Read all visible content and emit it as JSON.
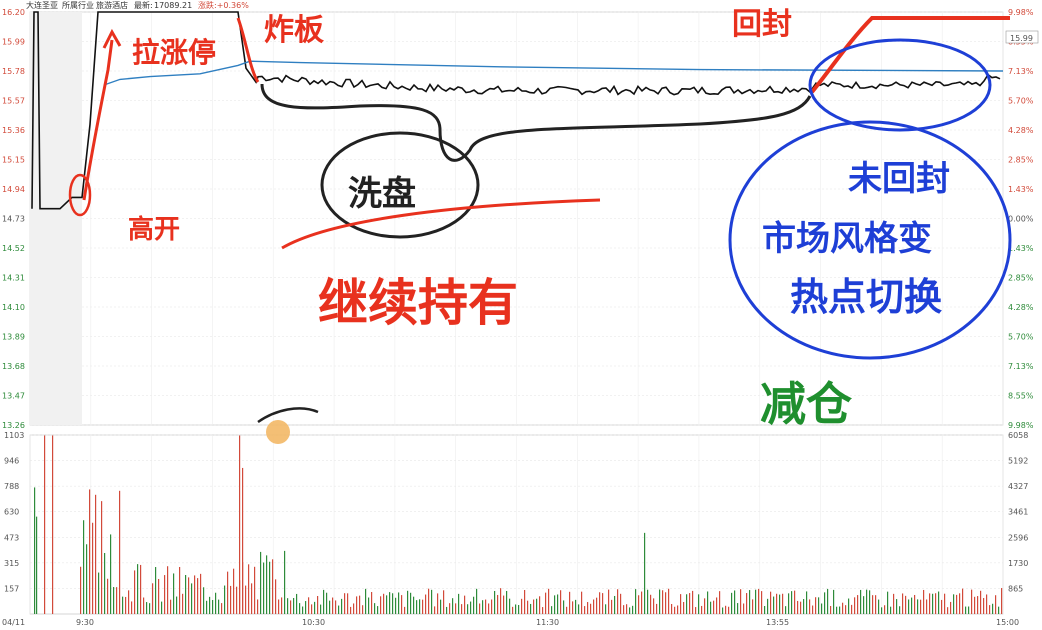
{
  "header": {
    "stock_name": "大连圣亚",
    "industry": "所属行业",
    "sector": "旅游酒店",
    "index_label": "最新:",
    "index_value": "17089.21",
    "change_label": "涨跌:+0.36%",
    "current_price_tag": "15.99"
  },
  "chart_data": [
    {
      "type": "line",
      "panel": "price",
      "series": [
        {
          "name": "price",
          "color": "#000000"
        },
        {
          "name": "avg_price",
          "color": "#2f7fc1"
        }
      ],
      "ylim": [
        13.26,
        16.2
      ],
      "y_ticks": [
        "16.20",
        "15.99",
        "15.78",
        "15.57",
        "15.36",
        "15.15",
        "14.94",
        "14.73",
        "14.52",
        "14.31",
        "14.10",
        "13.89",
        "13.68",
        "13.47",
        "13.26"
      ],
      "pct_ticks": [
        "9.98%",
        "8.55%",
        "7.13%",
        "5.70%",
        "4.28%",
        "2.85%",
        "1.43%",
        "0.00%",
        "1.43%",
        "2.85%",
        "4.28%",
        "5.70%",
        "7.13%",
        "8.55%",
        "9.98%"
      ],
      "x_ticks": [
        "04/11",
        "9:30",
        "10:30",
        "11:30",
        "13:55",
        "15:00"
      ],
      "grid": true
    },
    {
      "type": "bar",
      "panel": "volume",
      "ylim": [
        0,
        1103
      ],
      "y_ticks": [
        "1103",
        "946",
        "788",
        "630",
        "473",
        "315",
        "157"
      ],
      "y_ticks_right": [
        "6058",
        "5192",
        "4327",
        "3461",
        "2596",
        "1730",
        "865"
      ],
      "grid": true
    }
  ],
  "annotations": {
    "high_open": "高开",
    "pull_limit_up": "拉涨停",
    "break_board": "炸板",
    "reseal": "回封",
    "wash_plate": "洗盘",
    "keep_holding": "继续持有",
    "not_resealed": "未回封",
    "style_change": "市场风格变",
    "hotspot_switch": "热点切换",
    "reduce_position": "减仓"
  }
}
